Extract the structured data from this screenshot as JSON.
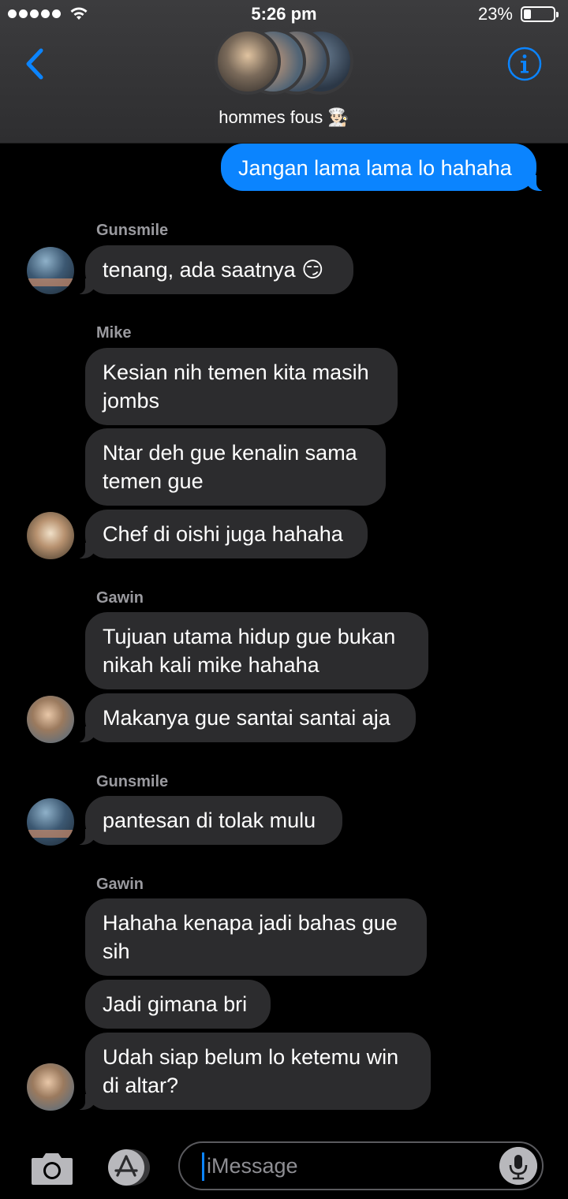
{
  "status_bar": {
    "time": "5:26 pm",
    "battery": "23%",
    "battery_level": 0.23
  },
  "header": {
    "back_icon": "chevron-left-icon",
    "info_icon": "info-icon",
    "group_name": "hommes fous 👨🏻‍🍳"
  },
  "messages": {
    "m1": "Jangan lama lama lo hahaha",
    "s1": "Gunsmile",
    "m2": "tenang, ada saatnya 😏",
    "s2": "Mike",
    "m3": "Kesian nih temen kita masih jombs",
    "m4": "Ntar deh gue kenalin sama temen gue",
    "m5": "Chef di oishi juga hahaha",
    "s3": "Gawin",
    "m6": "Tujuan utama hidup gue bukan nikah kali mike hahaha",
    "m7": "Makanya gue santai santai aja",
    "s4": "Gunsmile",
    "m8": "pantesan di tolak mulu",
    "s5": "Gawin",
    "m9": "Hahaha kenapa jadi bahas gue sih",
    "m10": "Jadi gimana bri",
    "m11": "Udah siap belum lo ketemu win di altar?"
  },
  "composer": {
    "placeholder": "iMessage",
    "camera_icon": "camera-icon",
    "apps_icon": "app-store-icon",
    "mic_icon": "microphone-icon"
  },
  "colors": {
    "outgoing": "#0b84fe",
    "incoming": "#2c2c2e",
    "accent": "#0b84fe"
  }
}
